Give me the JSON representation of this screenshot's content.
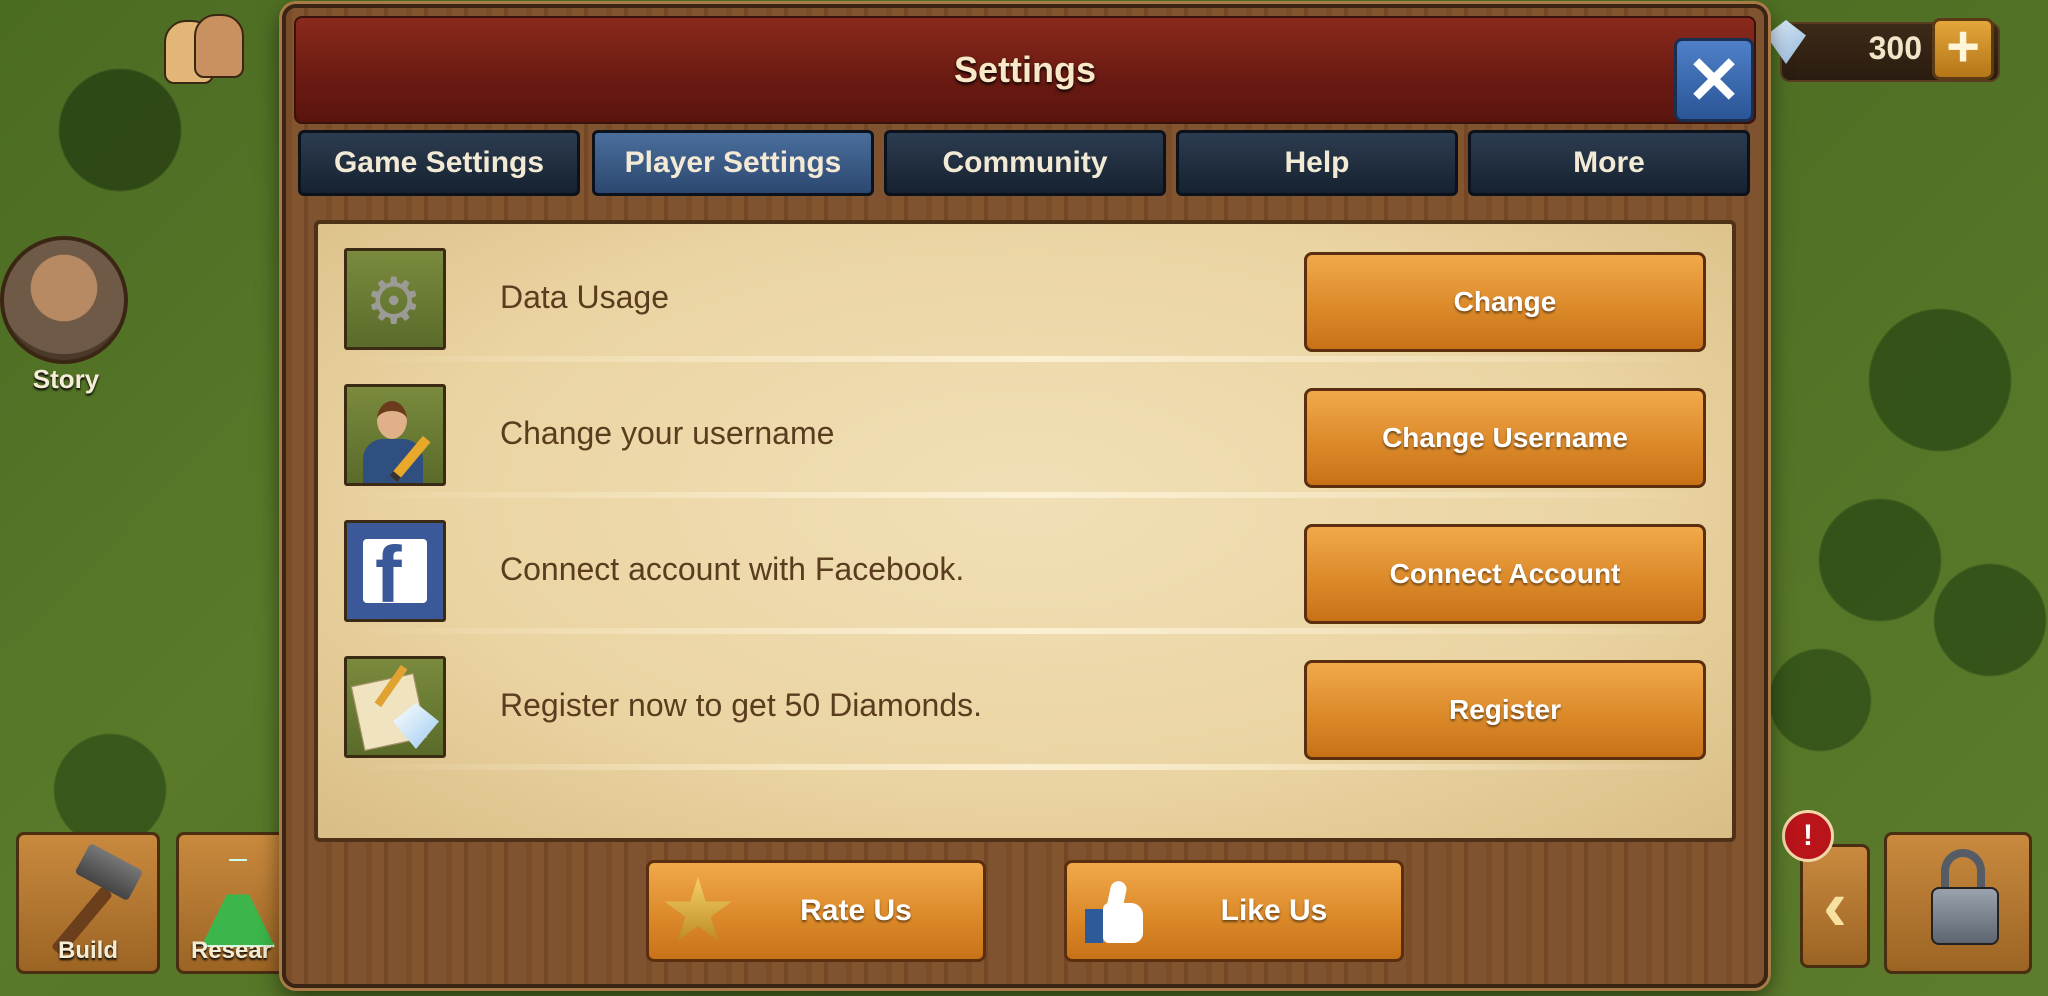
{
  "hud": {
    "gem_value": "300",
    "plus_glyph": "+",
    "story_label": "Story",
    "build_label": "Build",
    "research_label": "Resear",
    "alert_glyph": "!",
    "back_glyph": "‹"
  },
  "dialog": {
    "title": "Settings",
    "close_glyph": "✕",
    "tabs": [
      {
        "label": "Game Settings",
        "active": false
      },
      {
        "label": "Player Settings",
        "active": true
      },
      {
        "label": "Community",
        "active": false
      },
      {
        "label": "Help",
        "active": false
      },
      {
        "label": "More",
        "active": false
      }
    ],
    "rows": [
      {
        "icon": "gears-icon",
        "text": "Data Usage",
        "button": "Change"
      },
      {
        "icon": "user-edit-icon",
        "text": "Change your username",
        "button": "Change Username"
      },
      {
        "icon": "facebook-icon",
        "text": "Connect account with Facebook.",
        "button": "Connect Account"
      },
      {
        "icon": "register-diamonds-icon",
        "text": "Register now to get 50 Diamonds.",
        "button": "Register"
      }
    ],
    "bottom_buttons": [
      {
        "icon": "star-icon",
        "label": "Rate Us"
      },
      {
        "icon": "thumbs-up-icon",
        "label": "Like Us"
      }
    ]
  },
  "colors": {
    "title_bar": "#6a1a12",
    "tab": "#1e2c3c",
    "tab_active": "#3a5a86",
    "button_orange": "#dc8a2a",
    "close_blue": "#2a5596",
    "panel_parchment": "#ead4a2",
    "text_brown": "#5a3c1e"
  }
}
